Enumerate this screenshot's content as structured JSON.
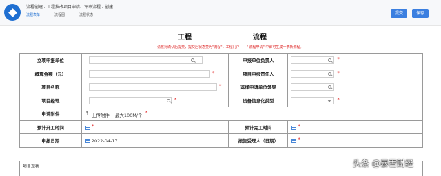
{
  "header": {
    "breadcrumb": "流程创建 - 工程技改项目申请、评审流程 - 创建",
    "tabs": [
      {
        "label": "流程表单"
      },
      {
        "label": "流程图"
      },
      {
        "label": "流程状态"
      }
    ],
    "buttons": {
      "submit": "提交",
      "save": "保存"
    }
  },
  "form": {
    "title_left": "工程",
    "title_right": "流程",
    "notice": "请核对确认后提交，提交后状态变为\"流程\"，工程门户——\"  流程申请\" 中即可生成一条新流程。",
    "rows": [
      {
        "l1": "立项申报单位",
        "l2": "申报单位负责人"
      },
      {
        "l1": "概算金额（元）",
        "l2": "项目申报责任人"
      },
      {
        "l1": "项目名称",
        "l2": "选择申请单位领导"
      },
      {
        "l1": "项目经理",
        "l2": "设备信息化类型"
      },
      {
        "l1": "申请附件",
        "upload_label": "上传附件",
        "upload_hint": "最大100M/个"
      },
      {
        "l1": "预计开工时间",
        "l2": "预计完工时间"
      },
      {
        "l1": "申报日期",
        "date_value": "2022-04-17",
        "l2": "报告受理人（日期）"
      }
    ],
    "last_label": "项目现状"
  },
  "watermark": "头条 @暴雪财经",
  "colors": {
    "accent": "#1f6fd1",
    "required": "#e02020"
  }
}
